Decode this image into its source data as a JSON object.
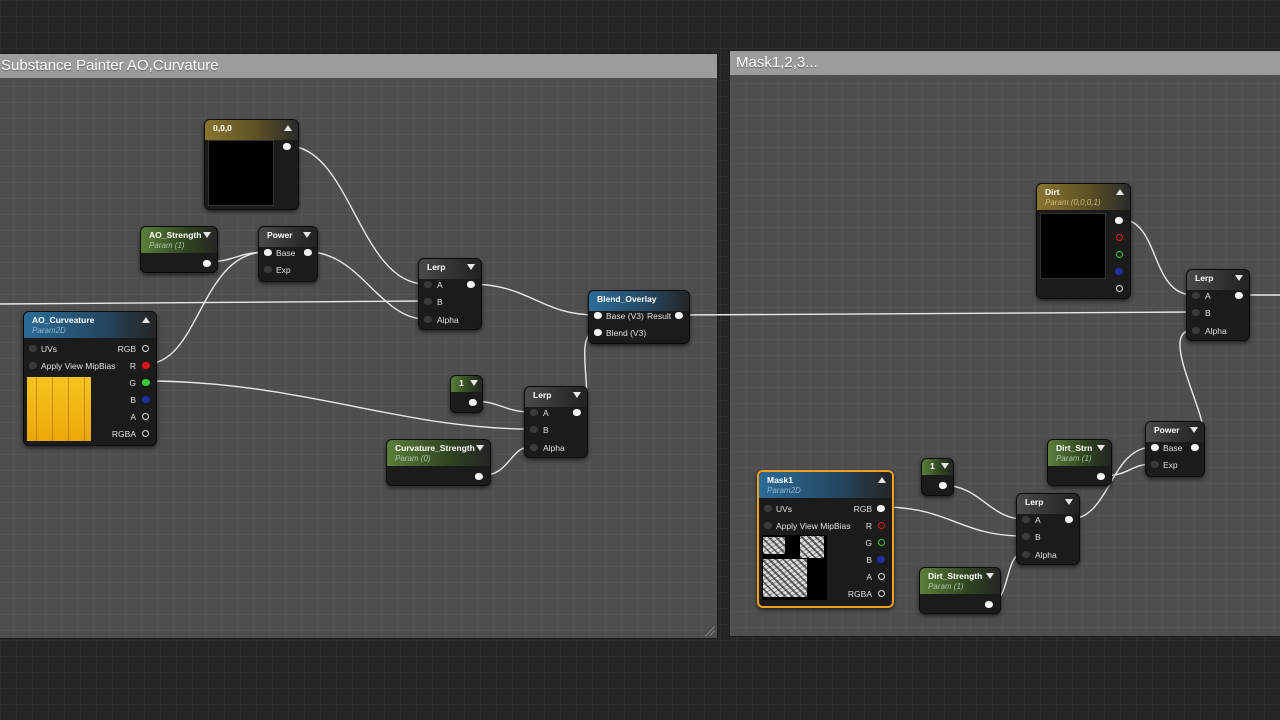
{
  "comments": [
    {
      "title": "Substance Painter AO,Curvature"
    },
    {
      "title": "Mask1,2,3..."
    }
  ],
  "nodes": {
    "color_const": {
      "title": "0,0,0"
    },
    "ao_strength": {
      "title": "AO_Strength",
      "subtitle": "Param (1)"
    },
    "power1": {
      "title": "Power",
      "pins": [
        "Base",
        "Exp"
      ]
    },
    "lerp1": {
      "title": "Lerp",
      "pins": [
        "A",
        "B",
        "Alpha"
      ]
    },
    "blend_overlay": {
      "title": "Blend_Overlay",
      "pins": [
        "Base (V3)",
        "Blend (V3)"
      ],
      "output": "Result"
    },
    "ao_curveature": {
      "title": "AO_Curveature",
      "subtitle": "Param2D",
      "inputs": [
        "UVs",
        "Apply View MipBias"
      ],
      "outputs": [
        "RGB",
        "R",
        "G",
        "B",
        "A",
        "RGBA"
      ]
    },
    "const_one_1": {
      "title": "1"
    },
    "lerp2": {
      "title": "Lerp",
      "pins": [
        "A",
        "B",
        "Alpha"
      ]
    },
    "curvature_strength": {
      "title": "Curvature_Strength",
      "subtitle": "Param (0)"
    },
    "dirt": {
      "title": "Dirt",
      "subtitle": "Param (0,0,0,1)"
    },
    "lerp3": {
      "title": "Lerp",
      "pins": [
        "A",
        "B",
        "Alpha"
      ]
    },
    "power2": {
      "title": "Power",
      "pins": [
        "Base",
        "Exp"
      ]
    },
    "dirt_strn": {
      "title": "Dirt_Strn",
      "subtitle": "Param (1)"
    },
    "const_one_2": {
      "title": "1"
    },
    "lerp4": {
      "title": "Lerp",
      "pins": [
        "A",
        "B",
        "Alpha"
      ]
    },
    "mask1": {
      "title": "Mask1",
      "subtitle": "Param2D",
      "inputs": [
        "UVs",
        "Apply View MipBias"
      ],
      "outputs": [
        "RGB",
        "R",
        "G",
        "B",
        "A",
        "RGBA"
      ]
    },
    "dirt_strength": {
      "title": "Dirt_Strength",
      "subtitle": "Param (1)"
    }
  },
  "colors": {
    "wire": "#e8e8e8",
    "comment_title_bg": "#9c9c9c",
    "comment_body_bg": "#4e4e4e",
    "selected_border": "#f0a020",
    "ao_preview": "#f2b40a"
  }
}
